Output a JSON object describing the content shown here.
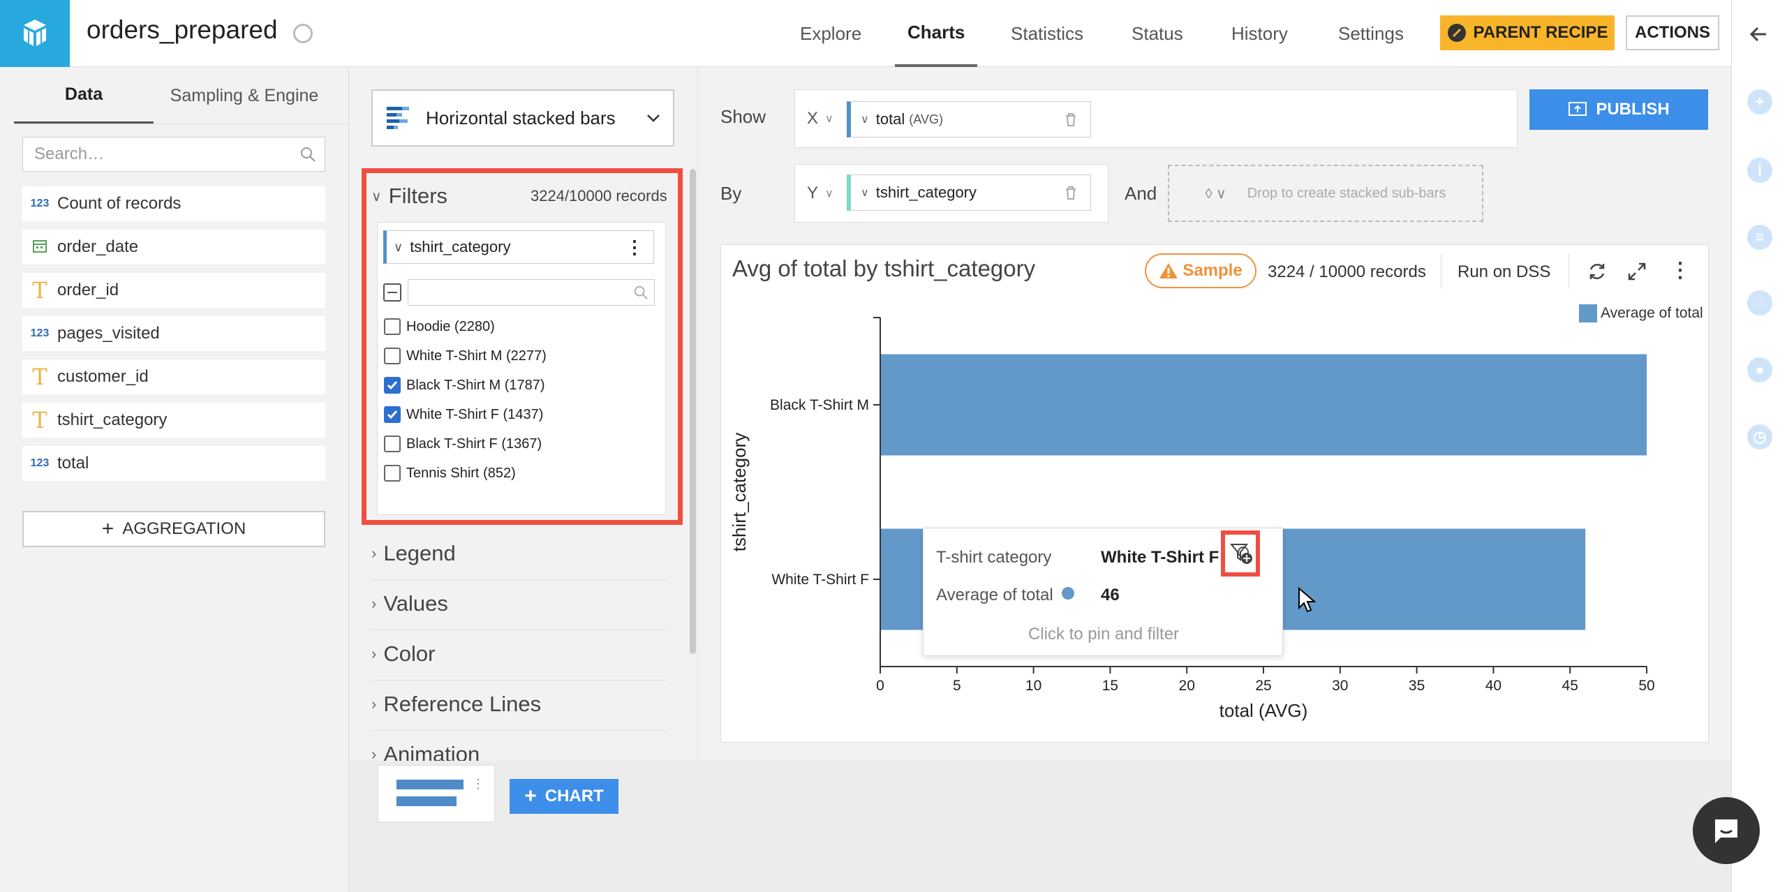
{
  "header": {
    "title": "orders_prepared",
    "nav": [
      "Explore",
      "Charts",
      "Statistics",
      "Status",
      "History",
      "Settings"
    ],
    "active_nav": "Charts",
    "parent_recipe": "PARENT RECIPE",
    "actions": "ACTIONS"
  },
  "left_panel": {
    "tabs": [
      "Data",
      "Sampling & Engine"
    ],
    "search_placeholder": "Search…",
    "fields": [
      {
        "type": "123",
        "name": "Count of records"
      },
      {
        "type": "date",
        "name": "order_date"
      },
      {
        "type": "T",
        "name": "order_id"
      },
      {
        "type": "123",
        "name": "pages_visited"
      },
      {
        "type": "T",
        "name": "customer_id"
      },
      {
        "type": "T",
        "name": "tshirt_category"
      },
      {
        "type": "123",
        "name": "total"
      }
    ],
    "aggregation_button": "AGGREGATION"
  },
  "config_panel": {
    "chart_type": "Horizontal stacked bars",
    "filters_title": "Filters",
    "filters_records": "3224/10000 records",
    "filter_dimension": "tshirt_category",
    "filter_values": [
      {
        "label": "Hoodie (2280)",
        "checked": false
      },
      {
        "label": "White T-Shirt M (2277)",
        "checked": false
      },
      {
        "label": "Black T-Shirt M (1787)",
        "checked": true
      },
      {
        "label": "White T-Shirt F (1437)",
        "checked": true
      },
      {
        "label": "Black T-Shirt F (1367)",
        "checked": false
      },
      {
        "label": "Tennis Shirt (852)",
        "checked": false
      }
    ],
    "sections": [
      "Legend",
      "Values",
      "Color",
      "Reference Lines",
      "Animation"
    ]
  },
  "shelves": {
    "show_label": "Show",
    "by_label": "By",
    "and_label": "And",
    "x_axis": "X",
    "y_axis": "Y",
    "x_measure": "total",
    "x_measure_agg": "(AVG)",
    "y_dimension": "tshirt_category",
    "drop_hint": "Drop to create stacked sub-bars",
    "publish": "PUBLISH"
  },
  "chart": {
    "title": "Avg of total by tshirt_category",
    "sample_label": "Sample",
    "records": "3224 / 10000 records",
    "run_on_dss": "Run on DSS",
    "legend_label": "Average of total"
  },
  "chart_data": {
    "type": "bar",
    "orientation": "horizontal",
    "title": "Avg of total by tshirt_category",
    "categories": [
      "Black T-Shirt M",
      "White T-Shirt F"
    ],
    "series": [
      {
        "name": "Average of total",
        "values": [
          50,
          46
        ]
      }
    ],
    "xlabel": "total (AVG)",
    "ylabel": "tshirt_category",
    "xlim": [
      0,
      50
    ],
    "xticks": [
      0,
      5,
      10,
      15,
      20,
      25,
      30,
      35,
      40,
      45,
      50
    ],
    "color": "#6399c9",
    "legend": "top-right",
    "grid": false
  },
  "tooltip": {
    "category_key": "T-shirt category",
    "category_value": "White T-Shirt F",
    "measure_key": "Average of total",
    "measure_value": "46",
    "hint": "Click to pin and filter"
  },
  "bottom": {
    "add_chart": "CHART"
  },
  "colors": {
    "accent": "#3d8ee8",
    "logo": "#28a9dd",
    "recipe": "#f8b52a",
    "highlight": "#f04e42",
    "bar": "#6399c9",
    "sample": "#f0923a"
  }
}
